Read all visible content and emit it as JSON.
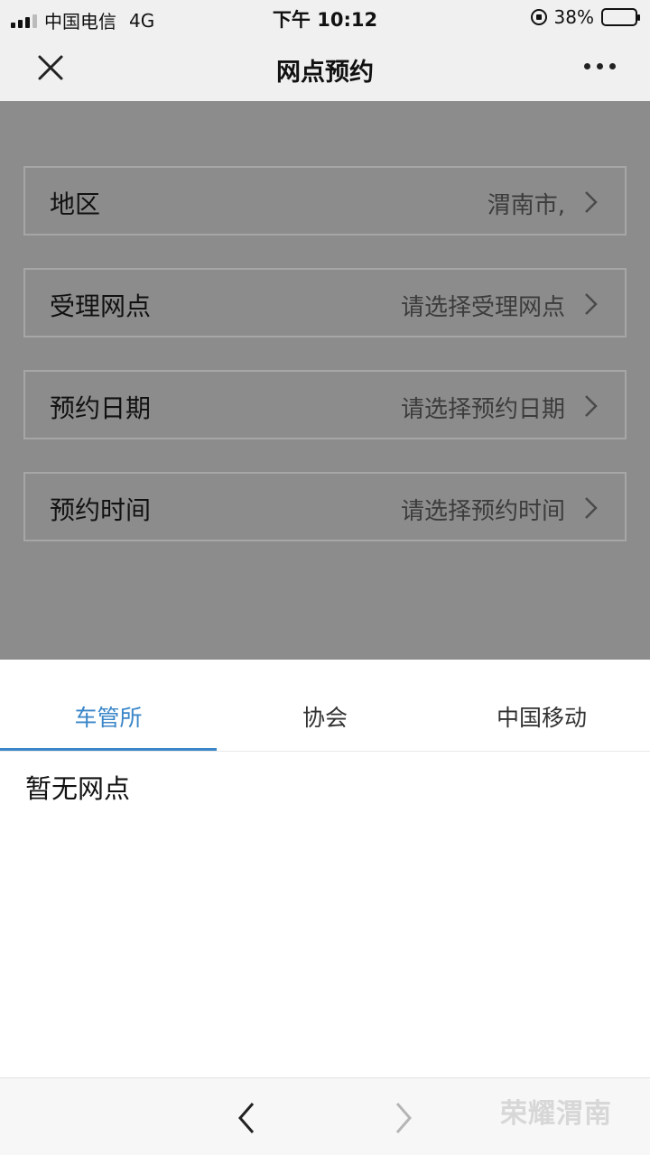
{
  "status_bar": {
    "carrier": "中国电信",
    "network": "4G",
    "time": "下午 10:12",
    "battery_percent": "38%",
    "battery_level": 0.38
  },
  "nav": {
    "title": "网点预约",
    "close_icon": "close-icon",
    "more_icon": "more-icon"
  },
  "form": {
    "rows": [
      {
        "label": "地区",
        "value": "渭南市,"
      },
      {
        "label": "受理网点",
        "value": "请选择受理网点"
      },
      {
        "label": "预约日期",
        "value": "请选择预约日期"
      },
      {
        "label": "预约时间",
        "value": "请选择预约时间"
      }
    ]
  },
  "sheet": {
    "tabs": [
      {
        "label": "车管所",
        "active": true
      },
      {
        "label": "协会",
        "active": false
      },
      {
        "label": "中国移动",
        "active": false
      }
    ],
    "empty_message": "暂无网点"
  },
  "toolbar": {
    "back_icon": "chevron-left-icon",
    "forward_icon": "chevron-right-icon",
    "watermark": "荣耀渭南"
  },
  "colors": {
    "accent": "#3a86c8",
    "overlay": "#8c8c8c",
    "bar_background": "#f0f0f0"
  }
}
